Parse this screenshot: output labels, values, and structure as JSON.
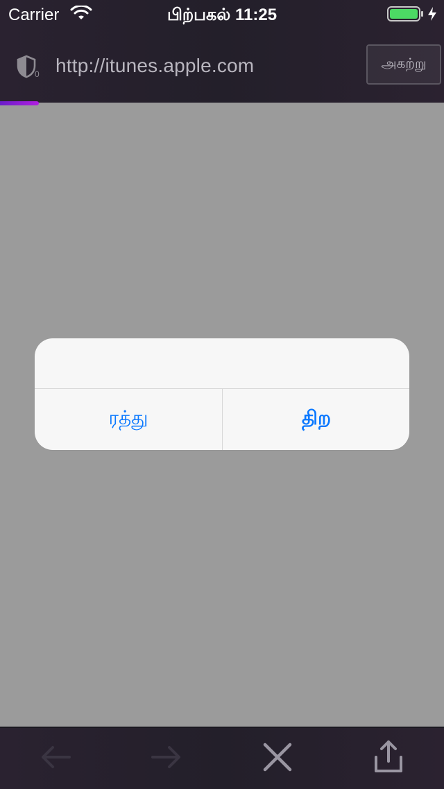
{
  "status_bar": {
    "carrier": "Carrier",
    "time": "பிற்பகல் 11:25"
  },
  "url_bar": {
    "url": "http://itunes.apple.com",
    "close_label": "அகற்று",
    "progress": 0.09
  },
  "dialog": {
    "cancel_label": "ரத்து",
    "open_label": "திற"
  },
  "colors": {
    "accent": "#0a78ff",
    "overlay": "#9b9b9b",
    "bar": "#2a2230",
    "progress_start": "#6a1cc9",
    "progress_end": "#b11fe0"
  },
  "toolbar": {
    "icons": [
      "back-arrow-icon",
      "forward-arrow-icon",
      "close-icon",
      "share-icon"
    ]
  }
}
